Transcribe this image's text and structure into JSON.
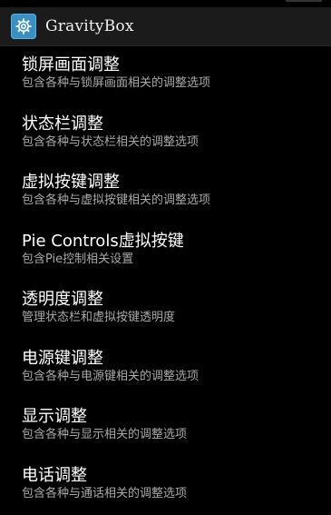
{
  "app": {
    "title": "GravityBox",
    "icon": "gear-icon"
  },
  "colors": {
    "background": "#000000",
    "actionbar": "#1b1b1b",
    "icon_bg": "#3a8fc4",
    "title_text": "#ffffff",
    "summary_text": "#a8a8a8"
  },
  "settings": [
    {
      "title": "锁屏画面调整",
      "summary": "包含各种与锁屏画面相关的调整选项"
    },
    {
      "title": "状态栏调整",
      "summary": "包含各种与状态栏相关的调整选项"
    },
    {
      "title": "虚拟按键调整",
      "summary": "包含各种与虚拟按键相关的调整选项"
    },
    {
      "title": "Pie Controls虚拟按键",
      "summary": "包含Pie控制相关设置"
    },
    {
      "title": "透明度调整",
      "summary": "管理状态栏和虚拟按键透明度"
    },
    {
      "title": "电源键调整",
      "summary": "包含各种与电源键相关的调整选项"
    },
    {
      "title": "显示调整",
      "summary": "包含各种与显示相关的调整选项"
    },
    {
      "title": "电话调整",
      "summary": "包含各种与通话相关的调整选项"
    }
  ]
}
